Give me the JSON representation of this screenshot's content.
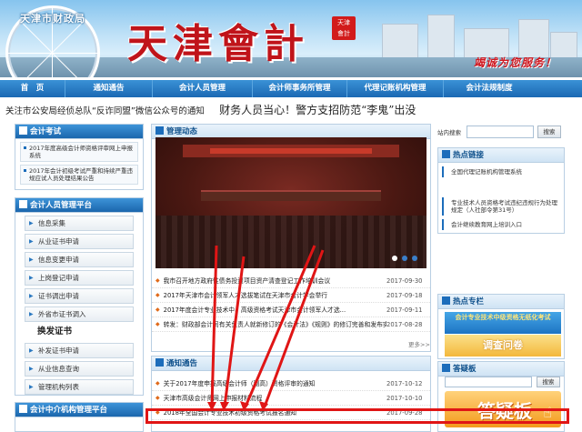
{
  "banner": {
    "site_name": "天津市财政局",
    "logo_text": "天津會計",
    "seal_text": "天津會計",
    "slogan": "竭诚为您服务！"
  },
  "nav": [
    "首　页",
    "通知通告",
    "会计人员管理",
    "会计师事务所管理",
    "代理记账机构管理",
    "会计法规制度"
  ],
  "ticker": {
    "item1": "关注市公安局经侦总队“反诈同盟”微信公众号的通知",
    "item2": "财务人员当心！警方支招防范“李鬼”出没"
  },
  "left": {
    "exam": {
      "title": "会计考试",
      "items": [
        "2017年度高级会计师资格评审网上申报系统",
        "2017年会计初级考试严重和持续严重违规应试人员处理结果公告"
      ]
    },
    "staff": {
      "title": "会计人员管理平台",
      "items": [
        "信息采集",
        "从业证书申请",
        "信息变更申请",
        "上岗登记申请",
        "证书调出申请",
        "外省市证书调入"
      ],
      "section": "换发证书",
      "items2": [
        "补发证书申请",
        "从业信息查询",
        "管理机构列表"
      ]
    },
    "agency": {
      "title": "会计中介机构管理平台"
    }
  },
  "middle": {
    "news": {
      "title": "管理动态",
      "rows": [
        {
          "title": "我市召开地方政府性债务投资项目资产清查登记工作培训会议",
          "date": "2017-09-30"
        },
        {
          "title": "2017年天津市会计领军人才选拔笔试在天津市会计学会举行",
          "date": "2017-09-18"
        },
        {
          "title": "2017年度会计专业技术中、高级资格考试天津市会计领军人才选...",
          "date": "2017-09-11"
        },
        {
          "title": "转发：财政部会计司有关负责人就新修订的《会计法》《规则》的修订完善和发布实施...",
          "date": "2017-08-28"
        }
      ],
      "more": "更多>>"
    },
    "notice": {
      "title": "通知通告",
      "rows": [
        {
          "title": "关于2017年度申报高级会计师（副高）资格评审的通知",
          "date": "2017-10-12"
        },
        {
          "title": "天津市高级会计师网上申报材料流程",
          "date": "2017-10-10"
        },
        {
          "title": "2018年全国会计专业技术初级资格考试报名通知",
          "date": "2017-09-28"
        }
      ]
    }
  },
  "right": {
    "search": {
      "label": "站内搜索",
      "button": "搜索"
    },
    "links": {
      "title": "热点链接",
      "items": [
        "全国代理记账机构管理系统",
        "专业技术人员资格考试违纪违规行为处理规定（人社部令第31号）",
        "会计继续教育网上培训入口"
      ]
    },
    "special": {
      "title": "热点专栏",
      "promo1": "会计专业技术中级资格无纸化考试",
      "promo2": "调查问卷"
    },
    "faq": {
      "title": "答疑板",
      "button": "搜索",
      "banner": "答疑板"
    }
  },
  "colors": {
    "accent": "#1c6dbb",
    "highlight": "#e01515",
    "brand_red": "#c0141a"
  }
}
